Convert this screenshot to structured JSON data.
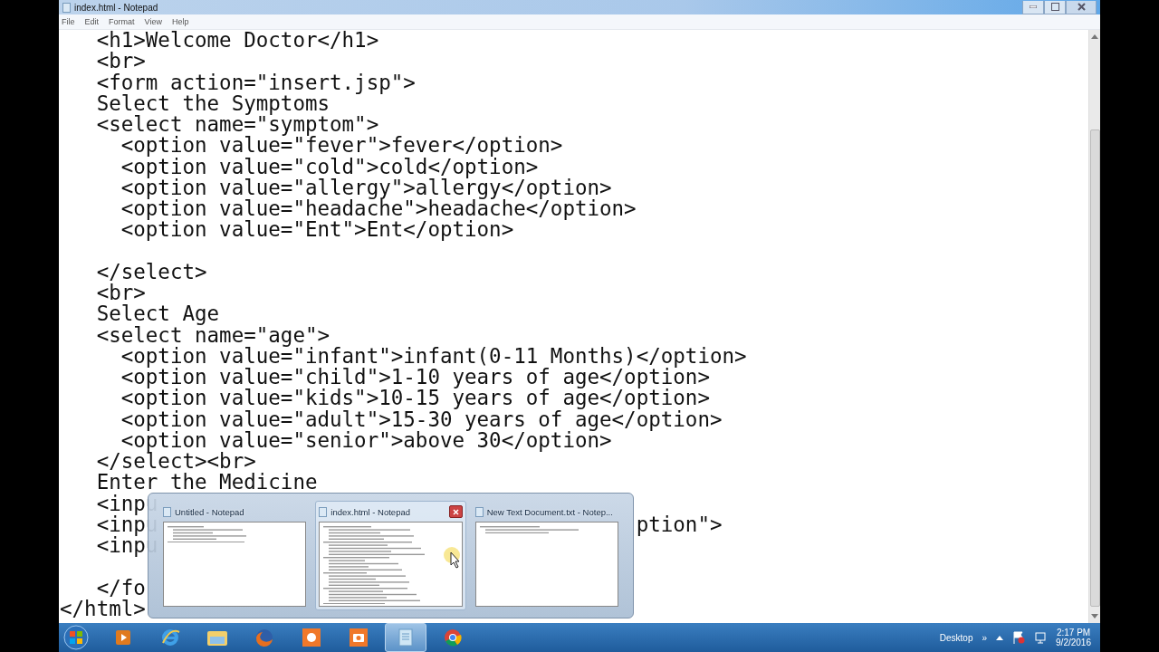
{
  "window": {
    "title": "index.html - Notepad"
  },
  "menu": [
    "File",
    "Edit",
    "Format",
    "View",
    "Help"
  ],
  "editor": {
    "lines": [
      {
        "kind": "code",
        "text": "   <h1>Welcome Doctor</h1>"
      },
      {
        "kind": "code",
        "text": "   <br>"
      },
      {
        "kind": "code",
        "text": "   <form action=\"insert.jsp\">"
      },
      {
        "kind": "code",
        "text": "   Select the Symptoms"
      },
      {
        "kind": "code",
        "text": "   <select name=\"symptom\">"
      },
      {
        "kind": "code",
        "text": "     <option value=\"fever\">fever</option>"
      },
      {
        "kind": "code",
        "text": "     <option value=\"cold\">cold</option>"
      },
      {
        "kind": "code",
        "text": "     <option value=\"allergy\">allergy</option>"
      },
      {
        "kind": "code",
        "text": "     <option value=\"headache\">headache</option>"
      },
      {
        "kind": "code",
        "text": "     <option value=\"Ent\">Ent</option>"
      },
      {
        "kind": "blank"
      },
      {
        "kind": "code",
        "text": "   </select>"
      },
      {
        "kind": "code",
        "text": "   <br>"
      },
      {
        "kind": "code",
        "text": "   Select Age"
      },
      {
        "kind": "code",
        "text": "   <select name=\"age\">"
      },
      {
        "kind": "code",
        "text": "     <option value=\"infant\">infant(0-11 Months)</option>"
      },
      {
        "kind": "code",
        "text": "     <option value=\"child\">1-10 years of age</option>"
      },
      {
        "kind": "code",
        "text": "     <option value=\"kids\">10-15 years of age</option>"
      },
      {
        "kind": "code",
        "text": "     <option value=\"adult\">15-30 years of age</option>"
      },
      {
        "kind": "code",
        "text": "     <option value=\"senior\">above 30</option>"
      },
      {
        "kind": "code",
        "text": "   </select><br>"
      },
      {
        "kind": "code",
        "text": "   Enter the Medicine"
      },
      {
        "kind": "code",
        "text": "   <inpu"
      },
      {
        "kind": "code",
        "text": "   <inpu",
        "tail": "ption\">"
      },
      {
        "kind": "code",
        "text": "   <inpu"
      },
      {
        "kind": "blank"
      },
      {
        "kind": "code",
        "text": "   </fo"
      },
      {
        "kind": "code",
        "text": "</html>"
      }
    ]
  },
  "thumbnails": [
    {
      "title": "Untitled - Notepad",
      "selected": false
    },
    {
      "title": "index.html - Notepad",
      "selected": true
    },
    {
      "title": "New Text Document.txt - Notep...",
      "selected": false
    }
  ],
  "taskbar": {
    "apps": [
      {
        "kind": "media",
        "active": false
      },
      {
        "kind": "ie",
        "active": false
      },
      {
        "kind": "explorer",
        "active": false
      },
      {
        "kind": "firefox",
        "active": false
      },
      {
        "kind": "recorder",
        "active": false
      },
      {
        "kind": "camera",
        "active": false
      },
      {
        "kind": "notepad",
        "active": true
      },
      {
        "kind": "chrome",
        "active": false
      }
    ],
    "toolbar_label": "Desktop",
    "chevron": "»",
    "time": "2:17 PM",
    "date": "9/2/2016"
  }
}
